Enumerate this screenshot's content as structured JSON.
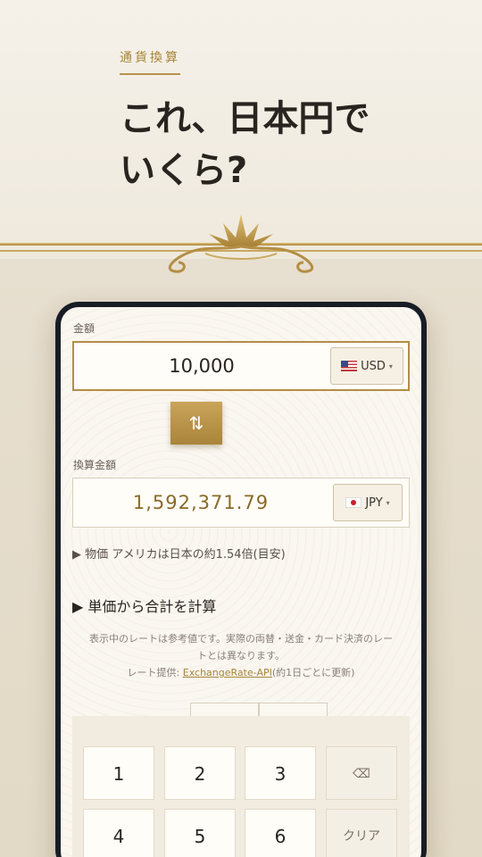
{
  "hero": {
    "kicker": "通貨換算",
    "headline_line1": "これ、日本円で",
    "headline_line2": "いくら?"
  },
  "converter": {
    "amount_label": "金額",
    "amount_value": "10,000",
    "from_currency": "USD",
    "swap_icon": "swap-vertical-arrows",
    "swap_glyph": "⇅",
    "result_label": "換算金額",
    "result_value": "1,592,371.79",
    "to_currency": "JPY",
    "price_comparison": "▶ 物価 アメリカは日本の約1.54倍(目安)",
    "section_title": "▶ 単価から合計を計算",
    "disclaimer_line1": "表示中のレートは参考値です。実際の両替・送金・カード決済のレー",
    "disclaimer_line2": "トとは異なります。",
    "disclaimer_prefix": "レート提供: ",
    "api_link": "ExchangeRate-API",
    "disclaimer_suffix": "(約1日ごとに更新)"
  },
  "keypad": {
    "keys": [
      "1",
      "2",
      "3",
      "4",
      "5",
      "6"
    ],
    "backspace_glyph": "⌫",
    "clear_label": "クリア"
  },
  "colors": {
    "accent_gold": "#b48e44",
    "frame_dark": "#181c24"
  }
}
